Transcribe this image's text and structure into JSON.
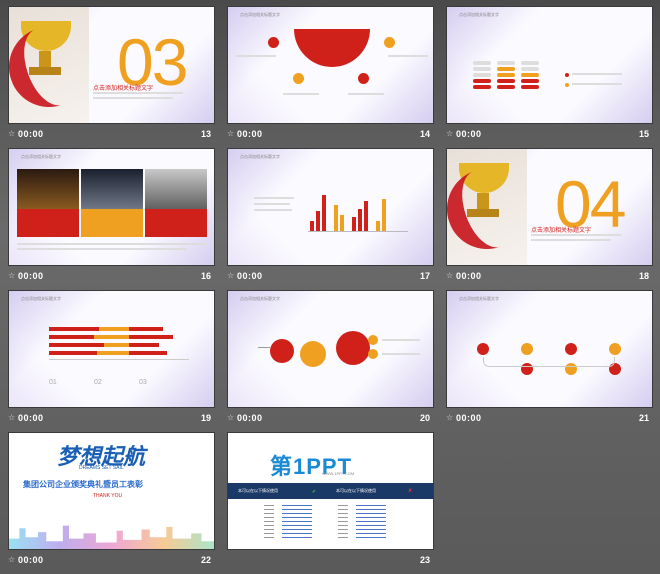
{
  "slides": [
    {
      "number": "13",
      "time": "00:00",
      "big_number": "03",
      "headline": "点击添加相关标题文字"
    },
    {
      "number": "14",
      "time": "00:00",
      "header": "点击添加相关标题文字"
    },
    {
      "number": "15",
      "time": "00:00",
      "header": "点击添加相关标题文字"
    },
    {
      "number": "16",
      "time": "00:00",
      "header": "点击添加相关标题文字"
    },
    {
      "number": "17",
      "time": "00:00",
      "header": "点击添加相关标题文字"
    },
    {
      "number": "18",
      "time": "00:00",
      "big_number": "04",
      "headline": "点击添加相关标题文字"
    },
    {
      "number": "19",
      "time": "00:00",
      "header": "点击添加相关标题文字",
      "items": [
        "01",
        "02",
        "03"
      ]
    },
    {
      "number": "20",
      "time": "00:00",
      "header": "点击添加相关标题文字"
    },
    {
      "number": "21",
      "time": "00:00",
      "header": "点击添加相关标题文字"
    },
    {
      "number": "22",
      "time": "00:00",
      "title": "梦想起航",
      "subtitle": "DREAMS SET SAIL",
      "line": "集团公司企业颁奖典礼暨员工表彰",
      "thanks": "THANK YOU"
    },
    {
      "number": "23",
      "time": "00:00",
      "logo": "第1PPT",
      "url": "WWW.1PPT.COM",
      "left_head": "本可以在以下情况使用",
      "right_head": "本可以在以下情况使用"
    }
  ],
  "colors": {
    "red": "#d0201a",
    "orange": "#f0a020",
    "navy": "#1b3966"
  }
}
